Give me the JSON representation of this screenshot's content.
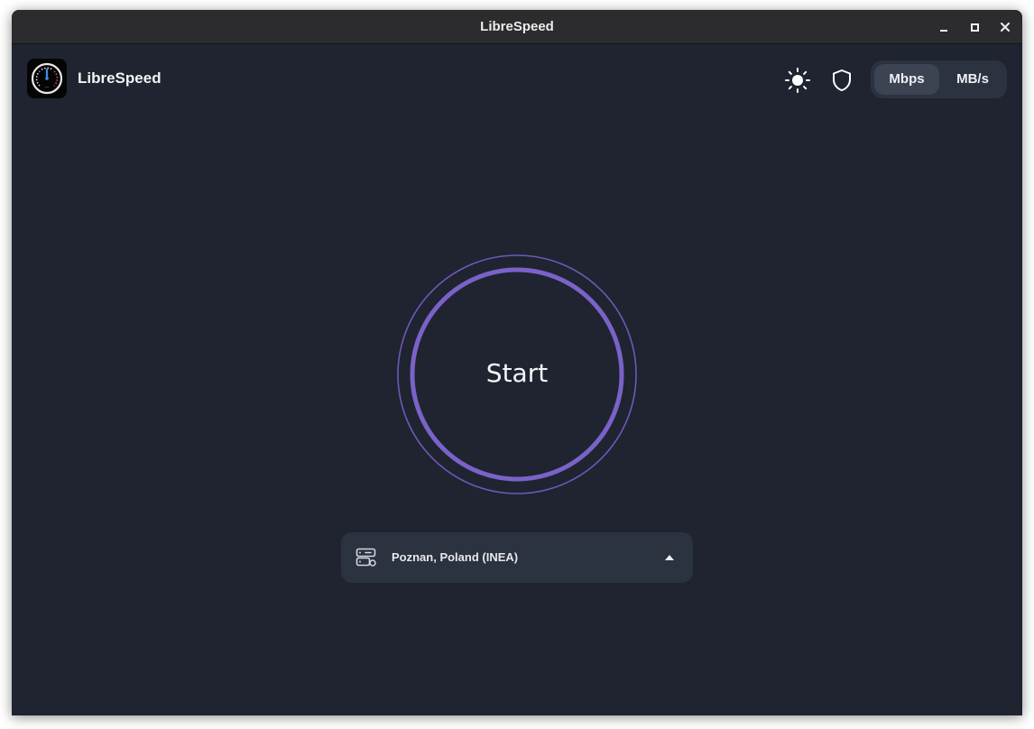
{
  "window": {
    "title": "LibreSpeed"
  },
  "header": {
    "app_name": "LibreSpeed",
    "theme_icon": "sun-icon",
    "privacy_icon": "shield-icon",
    "units": [
      {
        "label": "Mbps",
        "selected": true
      },
      {
        "label": "MB/s",
        "selected": false
      }
    ]
  },
  "main": {
    "start_label": "Start",
    "accent_color": "#7b62c9"
  },
  "server": {
    "icon": "server-icon",
    "name": "Poznan, Poland (INEA)",
    "chevron_icon": "chevron-up-icon"
  },
  "colors": {
    "background": "#1f2430",
    "titlebar": "#2c2c2e",
    "panel": "#2b3240",
    "accent": "#7b62c9"
  }
}
